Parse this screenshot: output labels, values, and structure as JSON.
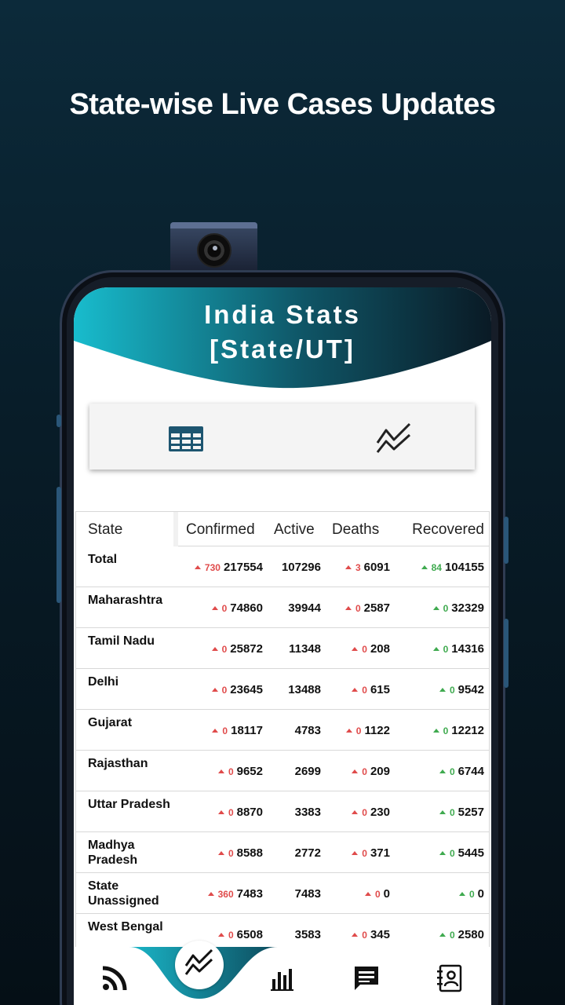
{
  "promo": {
    "title": "State-wise Live Cases Updates"
  },
  "app": {
    "header_line1": "India Stats",
    "header_line2": "[State/UT]",
    "colors": {
      "accent_teal": "#1ab6c8",
      "header_dark": "#0b1f2c",
      "delta_red": "#e04b4b",
      "delta_green": "#3faa4f"
    }
  },
  "view_toggle": {
    "table_view_icon": "table-grid-icon",
    "chart_view_icon": "trend-line-icon"
  },
  "table": {
    "headers": {
      "state": "State",
      "confirmed": "Confirmed",
      "active": "Active",
      "deaths": "Deaths",
      "recovered": "Recovered"
    },
    "rows": [
      {
        "state": "Total",
        "confirmed_delta": "730",
        "confirmed": "217554",
        "active": "107296",
        "deaths_delta": "3",
        "deaths": "6091",
        "recovered_delta": "84",
        "recovered": "104155"
      },
      {
        "state": "Maharashtra",
        "confirmed_delta": "0",
        "confirmed": "74860",
        "active": "39944",
        "deaths_delta": "0",
        "deaths": "2587",
        "recovered_delta": "0",
        "recovered": "32329"
      },
      {
        "state": "Tamil Nadu",
        "confirmed_delta": "0",
        "confirmed": "25872",
        "active": "11348",
        "deaths_delta": "0",
        "deaths": "208",
        "recovered_delta": "0",
        "recovered": "14316"
      },
      {
        "state": "Delhi",
        "confirmed_delta": "0",
        "confirmed": "23645",
        "active": "13488",
        "deaths_delta": "0",
        "deaths": "615",
        "recovered_delta": "0",
        "recovered": "9542"
      },
      {
        "state": "Gujarat",
        "confirmed_delta": "0",
        "confirmed": "18117",
        "active": "4783",
        "deaths_delta": "0",
        "deaths": "1122",
        "recovered_delta": "0",
        "recovered": "12212"
      },
      {
        "state": "Rajasthan",
        "confirmed_delta": "0",
        "confirmed": "9652",
        "active": "2699",
        "deaths_delta": "0",
        "deaths": "209",
        "recovered_delta": "0",
        "recovered": "6744"
      },
      {
        "state": "Uttar Pradesh",
        "confirmed_delta": "0",
        "confirmed": "8870",
        "active": "3383",
        "deaths_delta": "0",
        "deaths": "230",
        "recovered_delta": "0",
        "recovered": "5257"
      },
      {
        "state": "Madhya Pradesh",
        "confirmed_delta": "0",
        "confirmed": "8588",
        "active": "2772",
        "deaths_delta": "0",
        "deaths": "371",
        "recovered_delta": "0",
        "recovered": "5445"
      },
      {
        "state": "State Unassigned",
        "confirmed_delta": "360",
        "confirmed": "7483",
        "active": "7483",
        "deaths_delta": "0",
        "deaths": "0",
        "recovered_delta": "0",
        "recovered": "0"
      },
      {
        "state": "West Bengal",
        "confirmed_delta": "0",
        "confirmed": "6508",
        "active": "3583",
        "deaths_delta": "0",
        "deaths": "345",
        "recovered_delta": "0",
        "recovered": "2580"
      }
    ]
  },
  "bottom_nav": {
    "items": [
      {
        "icon": "rss-feed-icon"
      },
      {
        "icon": "trend-line-icon",
        "selected": true
      },
      {
        "icon": "bar-chart-icon"
      },
      {
        "icon": "chat-message-icon"
      },
      {
        "icon": "contacts-book-icon"
      }
    ]
  }
}
